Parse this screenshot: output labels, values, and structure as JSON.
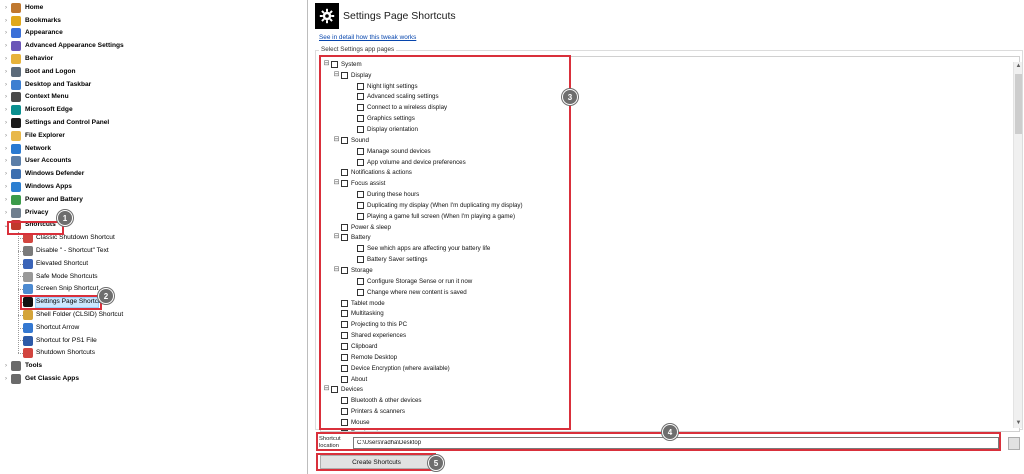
{
  "nav": {
    "top_items": [
      {
        "label": "Home",
        "icon": "home-icon",
        "color": "#c0782f",
        "expanded": false
      },
      {
        "label": "Bookmarks",
        "icon": "star-icon",
        "color": "#e0a81c",
        "expanded": false
      },
      {
        "label": "Appearance",
        "icon": "palette-icon",
        "color": "#3a6fd8",
        "expanded": false
      },
      {
        "label": "Advanced Appearance Settings",
        "icon": "paintbrush-icon",
        "color": "#6b56b8",
        "expanded": false
      },
      {
        "label": "Behavior",
        "icon": "cursor-icon",
        "color": "#e7b33b",
        "expanded": false
      },
      {
        "label": "Boot and Logon",
        "icon": "boot-icon",
        "color": "#5c6b7a",
        "expanded": false
      },
      {
        "label": "Desktop and Taskbar",
        "icon": "desktop-icon",
        "color": "#3d7fd1",
        "expanded": false
      },
      {
        "label": "Context Menu",
        "icon": "menu-icon",
        "color": "#4a4a4a",
        "expanded": false
      },
      {
        "label": "Microsoft Edge",
        "icon": "edge-icon",
        "color": "#0a8f8f",
        "expanded": false
      },
      {
        "label": "Settings and Control Panel",
        "icon": "gear-icon",
        "color": "#1a1a1a",
        "expanded": false
      },
      {
        "label": "File Explorer",
        "icon": "folder-icon",
        "color": "#e8b84a",
        "expanded": false
      },
      {
        "label": "Network",
        "icon": "network-icon",
        "color": "#2a7ad1",
        "expanded": false
      },
      {
        "label": "User Accounts",
        "icon": "users-icon",
        "color": "#5b7ea8",
        "expanded": false
      },
      {
        "label": "Windows Defender",
        "icon": "shield-icon",
        "color": "#3d6fb0",
        "expanded": false
      },
      {
        "label": "Windows Apps",
        "icon": "apps-icon",
        "color": "#2c7fd1",
        "expanded": false
      },
      {
        "label": "Power and Battery",
        "icon": "battery-icon",
        "color": "#3b9a4a",
        "expanded": false
      },
      {
        "label": "Privacy",
        "icon": "privacy-icon",
        "color": "#6f7f8f",
        "expanded": false
      },
      {
        "label": "Shortcuts",
        "icon": "shortcut-icon",
        "color": "#c0392b",
        "expanded": true
      }
    ],
    "shortcut_children": [
      {
        "label": "Classic Shutdown Shortcut",
        "icon": "shutdown-icon",
        "color": "#d2453f"
      },
      {
        "label": "Disable \" - Shortcut\" Text",
        "icon": "text-icon",
        "color": "#7a7a7a"
      },
      {
        "label": "Elevated Shortcut",
        "icon": "elevated-icon",
        "color": "#3a64b8"
      },
      {
        "label": "Safe Mode Shortcuts",
        "icon": "safe-mode-icon",
        "color": "#999999"
      },
      {
        "label": "Screen Snip Shortcut",
        "icon": "scissors-icon",
        "color": "#4c8ad1"
      },
      {
        "label": "Settings Page Shortcuts",
        "icon": "gear-icon",
        "color": "#111111",
        "selected": true
      },
      {
        "label": "Shell Folder (CLSID) Shortcut",
        "icon": "shell-folder-icon",
        "color": "#d4a43a"
      },
      {
        "label": "Shortcut Arrow",
        "icon": "arrow-icon",
        "color": "#3478d1"
      },
      {
        "label": "Shortcut for PS1 File",
        "icon": "powershell-icon",
        "color": "#2d5aa8"
      },
      {
        "label": "Shutdown Shortcuts",
        "icon": "power-icon",
        "color": "#d2453f"
      }
    ],
    "bottom_items": [
      {
        "label": "Tools",
        "icon": "tools-icon",
        "color": "#6a6a6a",
        "expanded": false
      },
      {
        "label": "Get Classic Apps",
        "icon": "classic-apps-icon",
        "color": "#6a6a6a",
        "expanded": false
      }
    ]
  },
  "panel": {
    "title": "Settings Page Shortcuts",
    "link": "See in detail how this tweak works",
    "group_label": "Select Settings app pages"
  },
  "settings_tree": [
    {
      "label": "System",
      "level": 0,
      "expandable": true
    },
    {
      "label": "Display",
      "level": 1,
      "expandable": true
    },
    {
      "label": "Night light settings",
      "level": 2,
      "expandable": false
    },
    {
      "label": "Advanced scaling settings",
      "level": 2,
      "expandable": false
    },
    {
      "label": "Connect to a wireless display",
      "level": 2,
      "expandable": false
    },
    {
      "label": "Graphics settings",
      "level": 2,
      "expandable": false
    },
    {
      "label": "Display orientation",
      "level": 2,
      "expandable": false
    },
    {
      "label": "Sound",
      "level": 1,
      "expandable": true
    },
    {
      "label": "Manage sound devices",
      "level": 2,
      "expandable": false
    },
    {
      "label": "App volume and device preferences",
      "level": 2,
      "expandable": false
    },
    {
      "label": "Notifications & actions",
      "level": 1,
      "expandable": false
    },
    {
      "label": "Focus assist",
      "level": 1,
      "expandable": true
    },
    {
      "label": "During these hours",
      "level": 2,
      "expandable": false
    },
    {
      "label": "Duplicating my display (When I'm duplicating my display)",
      "level": 2,
      "expandable": false
    },
    {
      "label": "Playing a game full screen (When I'm playing a game)",
      "level": 2,
      "expandable": false
    },
    {
      "label": "Power & sleep",
      "level": 1,
      "expandable": false
    },
    {
      "label": "Battery",
      "level": 1,
      "expandable": true
    },
    {
      "label": "See which apps are affecting your battery life",
      "level": 2,
      "expandable": false
    },
    {
      "label": "Battery Saver settings",
      "level": 2,
      "expandable": false
    },
    {
      "label": "Storage",
      "level": 1,
      "expandable": true
    },
    {
      "label": "Configure Storage Sense or run it now",
      "level": 2,
      "expandable": false
    },
    {
      "label": "Change where new content is saved",
      "level": 2,
      "expandable": false
    },
    {
      "label": "Tablet mode",
      "level": 1,
      "expandable": false
    },
    {
      "label": "Multitasking",
      "level": 1,
      "expandable": false
    },
    {
      "label": "Projecting to this PC",
      "level": 1,
      "expandable": false
    },
    {
      "label": "Shared experiences",
      "level": 1,
      "expandable": false
    },
    {
      "label": "Clipboard",
      "level": 1,
      "expandable": false
    },
    {
      "label": "Remote Desktop",
      "level": 1,
      "expandable": false
    },
    {
      "label": "Device Encryption (where available)",
      "level": 1,
      "expandable": false
    },
    {
      "label": "About",
      "level": 1,
      "expandable": false
    },
    {
      "label": "Devices",
      "level": 0,
      "expandable": true
    },
    {
      "label": "Bluetooth & other devices",
      "level": 1,
      "expandable": false
    },
    {
      "label": "Printers & scanners",
      "level": 1,
      "expandable": false
    },
    {
      "label": "Mouse",
      "level": 1,
      "expandable": false
    },
    {
      "label": "Touchpad",
      "level": 1,
      "expandable": false
    }
  ],
  "location": {
    "label": "Shortcut location",
    "value": "C:\\Users\\radha\\Desktop"
  },
  "create_button": "Create Shortcuts",
  "markers": [
    "1",
    "2",
    "3",
    "4",
    "5"
  ],
  "colors": {
    "highlight_red": "#d9303b",
    "marker_gray": "#6e6e6e",
    "selection_blue": "#cce8ff",
    "link_blue": "#0645ad"
  }
}
